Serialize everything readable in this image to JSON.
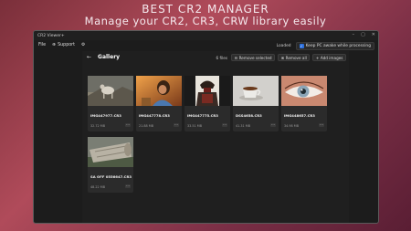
{
  "promo": {
    "headline": "BEST CR2 MANAGER",
    "subline": "Manage your CR2, CR3, CRW  library easily"
  },
  "app": {
    "title": "CR2 Viewer+"
  },
  "menu": {
    "file": "File",
    "support": "Support"
  },
  "status": {
    "loaded": "Loaded",
    "keep_awake": "Keep PC awake while processing"
  },
  "gallery": {
    "title": "Gallery",
    "file_count": "6 files",
    "remove_selected": "Remove selected",
    "remove_all": "Remove all",
    "add_images": "Add images",
    "files": [
      {
        "name": "IMG447977.CR3",
        "size": "32.72 MB",
        "thumb": "mountain-goat"
      },
      {
        "name": "IMG447778.CR3",
        "size": "21.88 MB",
        "thumb": "woman-sunset"
      },
      {
        "name": "IMG447775.CR3",
        "size": "33.51 MB",
        "thumb": "samurai-armor"
      },
      {
        "name": "DSS4658.CR3",
        "size": "41.31 MB",
        "thumb": "tea-cup"
      },
      {
        "name": "IMG448657.CR3",
        "size": "34.98 MB",
        "thumb": "eye-closeup"
      },
      {
        "name": "SA OFF 0556647.CR3",
        "size": "48.22 MB",
        "thumb": "old-wood-log"
      }
    ]
  },
  "colors": {
    "accent": "#2b6fde",
    "window_bg": "#1c1c1c",
    "card_bg": "#2b2b2b"
  }
}
